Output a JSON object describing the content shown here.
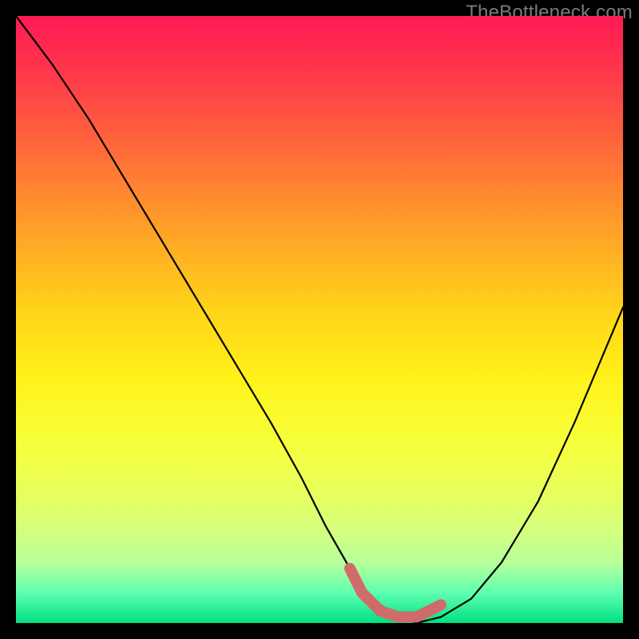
{
  "watermark": "TheBottleneck.com",
  "colors": {
    "background": "#000000",
    "curve": "#000000",
    "marker": "#d16a6a",
    "gradient_top": "#ff1a55",
    "gradient_bottom": "#00e080"
  },
  "chart_data": {
    "type": "line",
    "title": "",
    "xlabel": "",
    "ylabel": "",
    "xlim": [
      0,
      100
    ],
    "ylim": [
      0,
      100
    ],
    "grid": false,
    "legend": false,
    "series": [
      {
        "name": "bottleneck-curve",
        "x": [
          0,
          6,
          12,
          18,
          24,
          30,
          36,
          42,
          47,
          51,
          55,
          57,
          60,
          63,
          66,
          70,
          75,
          80,
          86,
          92,
          100
        ],
        "values": [
          100,
          92,
          83,
          73,
          63,
          53,
          43,
          33,
          24,
          16,
          9,
          6,
          3,
          1,
          0,
          1,
          4,
          10,
          20,
          33,
          52
        ]
      }
    ],
    "markers": {
      "name": "highlight-segment",
      "color": "#d16a6a",
      "x": [
        55,
        57,
        60,
        63,
        66,
        70
      ],
      "values": [
        9,
        5,
        2,
        1,
        1,
        3
      ]
    }
  }
}
